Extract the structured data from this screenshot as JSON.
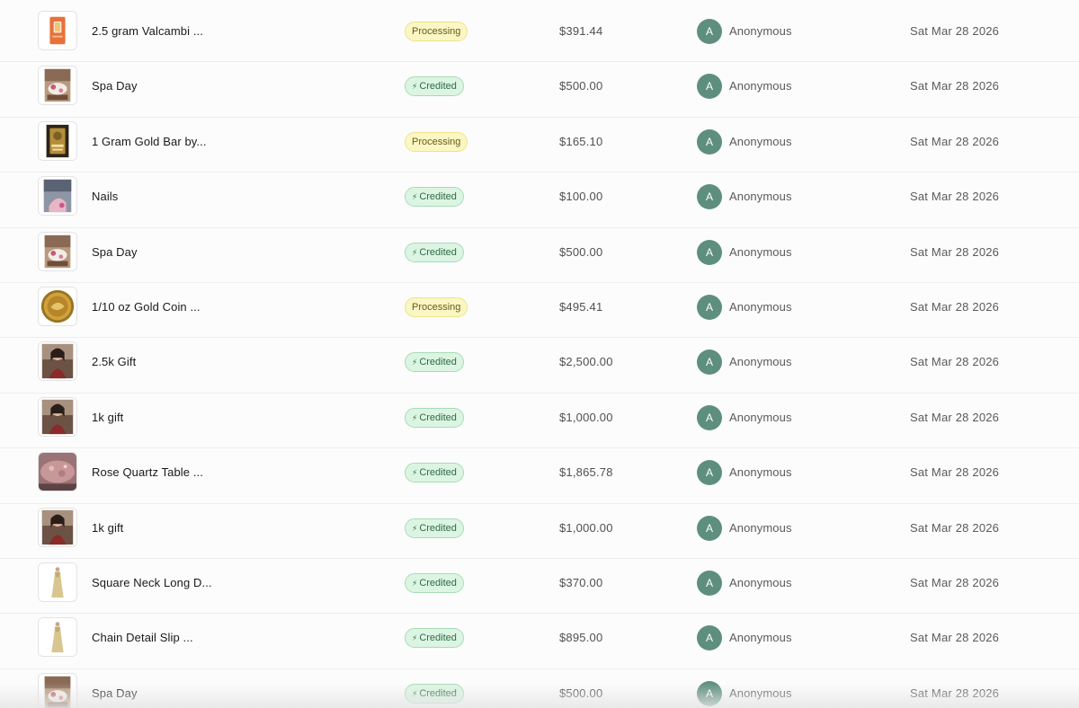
{
  "rows": [
    {
      "name": "2.5 gram Valcambi ...",
      "status": "Processing",
      "amount": "$391.44",
      "avatar": "A",
      "user": "Anonymous",
      "date": "Sat Mar 28 2026",
      "thumb": "orange-gold-bar-icon"
    },
    {
      "name": "Spa Day",
      "status": "Credited",
      "amount": "$500.00",
      "avatar": "A",
      "user": "Anonymous",
      "date": "Sat Mar 28 2026",
      "thumb": "spa-photo-icon"
    },
    {
      "name": "1 Gram Gold Bar by...",
      "status": "Processing",
      "amount": "$165.10",
      "avatar": "A",
      "user": "Anonymous",
      "date": "Sat Mar 28 2026",
      "thumb": "gold-bar-icon"
    },
    {
      "name": "Nails",
      "status": "Credited",
      "amount": "$100.00",
      "avatar": "A",
      "user": "Anonymous",
      "date": "Sat Mar 28 2026",
      "thumb": "nails-photo-icon"
    },
    {
      "name": "Spa Day",
      "status": "Credited",
      "amount": "$500.00",
      "avatar": "A",
      "user": "Anonymous",
      "date": "Sat Mar 28 2026",
      "thumb": "spa-photo-icon"
    },
    {
      "name": "1/10 oz Gold Coin ...",
      "status": "Processing",
      "amount": "$495.41",
      "avatar": "A",
      "user": "Anonymous",
      "date": "Sat Mar 28 2026",
      "thumb": "gold-coin-icon"
    },
    {
      "name": "2.5k Gift",
      "status": "Credited",
      "amount": "$2,500.00",
      "avatar": "A",
      "user": "Anonymous",
      "date": "Sat Mar 28 2026",
      "thumb": "portrait-photo-icon"
    },
    {
      "name": "1k gift",
      "status": "Credited",
      "amount": "$1,000.00",
      "avatar": "A",
      "user": "Anonymous",
      "date": "Sat Mar 28 2026",
      "thumb": "portrait-photo-icon"
    },
    {
      "name": "Rose Quartz Table ...",
      "status": "Credited",
      "amount": "$1,865.78",
      "avatar": "A",
      "user": "Anonymous",
      "date": "Sat Mar 28 2026",
      "thumb": "quartz-table-icon"
    },
    {
      "name": "1k gift",
      "status": "Credited",
      "amount": "$1,000.00",
      "avatar": "A",
      "user": "Anonymous",
      "date": "Sat Mar 28 2026",
      "thumb": "portrait-photo-icon"
    },
    {
      "name": "Square Neck Long D...",
      "status": "Credited",
      "amount": "$370.00",
      "avatar": "A",
      "user": "Anonymous",
      "date": "Sat Mar 28 2026",
      "thumb": "dress-icon"
    },
    {
      "name": "Chain Detail Slip ...",
      "status": "Credited",
      "amount": "$895.00",
      "avatar": "A",
      "user": "Anonymous",
      "date": "Sat Mar 28 2026",
      "thumb": "dress-icon"
    },
    {
      "name": "Spa Day",
      "status": "Credited",
      "amount": "$500.00",
      "avatar": "A",
      "user": "Anonymous",
      "date": "Sat Mar 28 2026",
      "thumb": "spa-photo-icon"
    }
  ],
  "icons": {
    "credited_badge_icon": "lightning-bolt-icon"
  },
  "colors": {
    "avatar_bg": "#5e8f7e",
    "processing_bg": "#fbf7c4",
    "credited_bg": "#dcf5e3"
  }
}
